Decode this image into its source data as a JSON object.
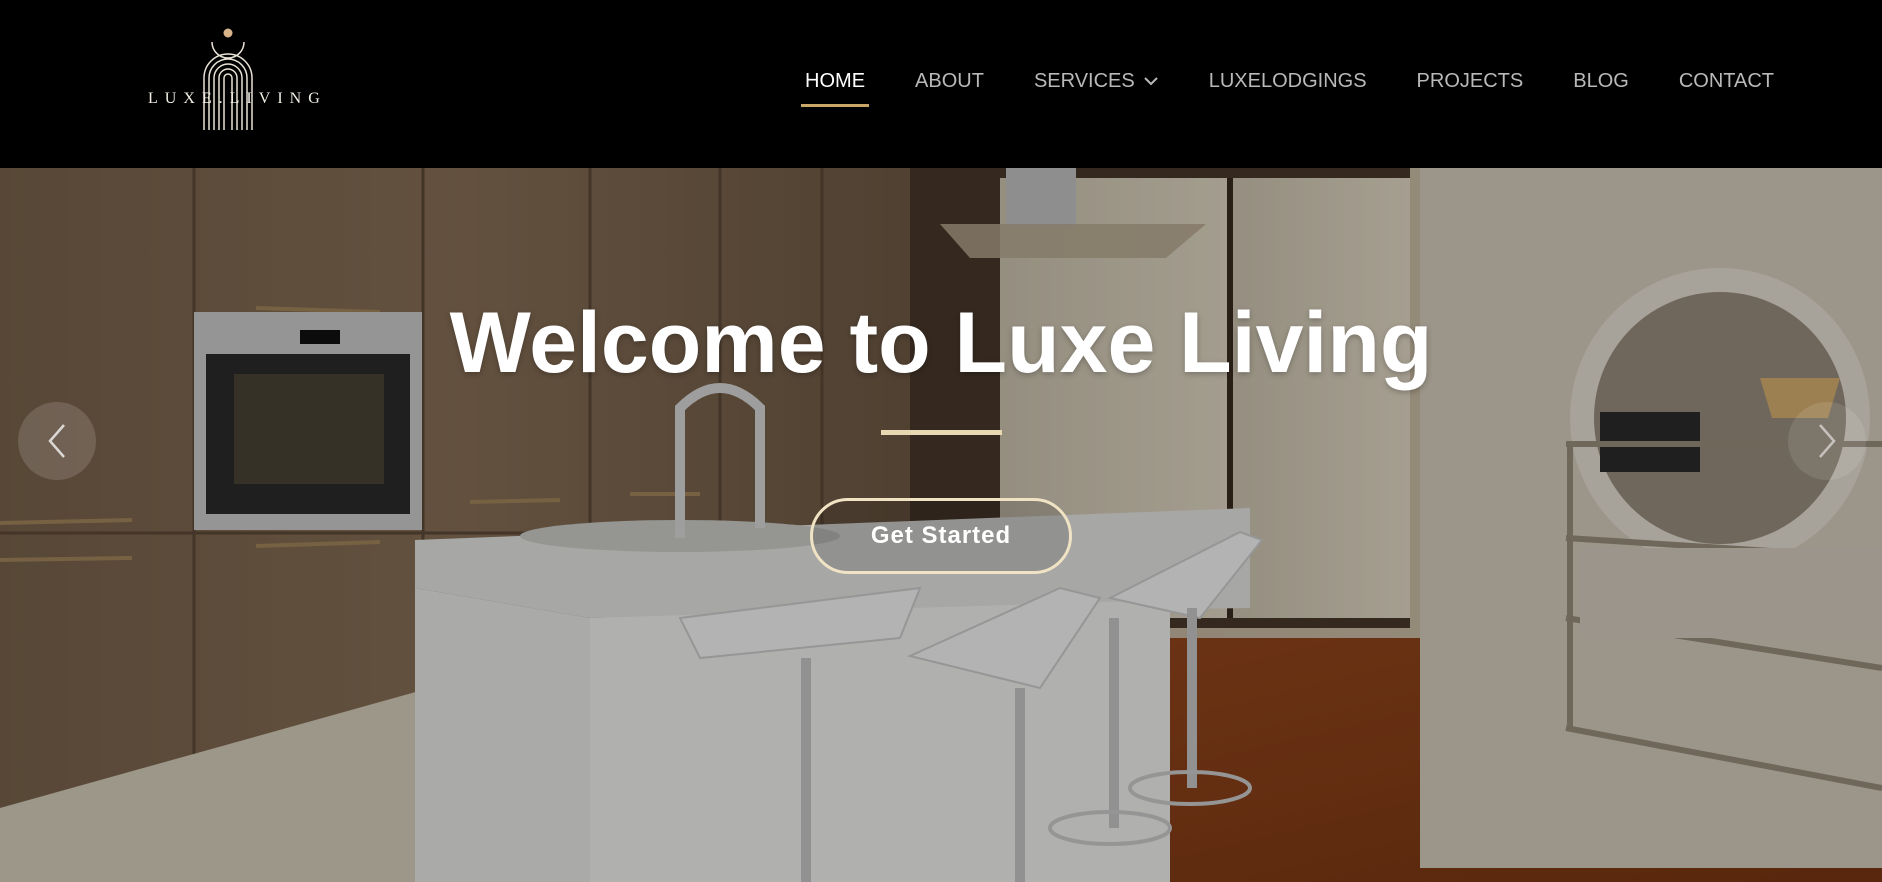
{
  "brand": {
    "name": "LUXE.LIVING",
    "accent_color": "#c9a769",
    "logo_icon": "arch-lines-logo-icon"
  },
  "nav": {
    "items": [
      {
        "label": "HOME",
        "active": true
      },
      {
        "label": "ABOUT",
        "active": false
      },
      {
        "label": "SERVICES",
        "active": false,
        "has_dropdown": true
      },
      {
        "label": "LUXELODGINGS",
        "active": false
      },
      {
        "label": "PROJECTS",
        "active": false
      },
      {
        "label": "BLOG",
        "active": false
      },
      {
        "label": "CONTACT",
        "active": false
      }
    ]
  },
  "hero": {
    "title": "Welcome to Luxe Living",
    "cta_label": "Get Started",
    "prev_icon": "chevron-left-icon",
    "next_icon": "chevron-right-icon",
    "background": "modern-kitchen-interior-photo"
  }
}
